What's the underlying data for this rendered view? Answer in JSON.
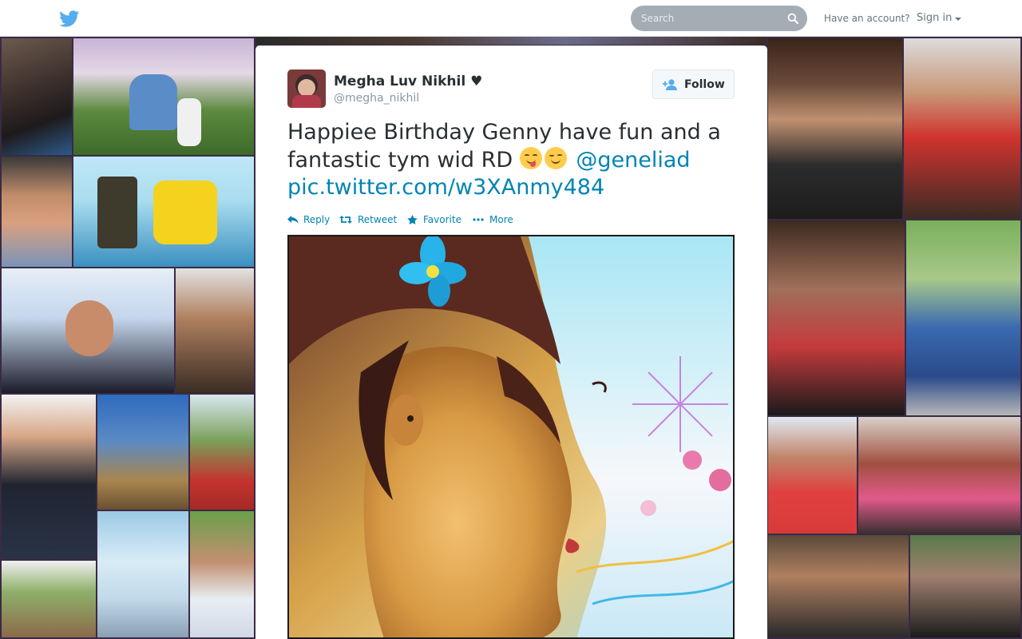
{
  "header": {
    "logo_icon": "twitter-bird-icon",
    "search": {
      "placeholder": "Search",
      "icon": "search-icon"
    },
    "have_account": "Have an account?",
    "signin_label": "Sign in",
    "brand_color": "#55acee"
  },
  "tweet": {
    "author": {
      "full_name": "Megha Luv Nikhil ♥",
      "screen_name": "@megha_nikhil"
    },
    "follow_label": "Follow",
    "text": "Happiee Birthday Genny have fun and a fantastic tym wid RD",
    "emojis": [
      "yum-face-emoji",
      "winking-face-emoji"
    ],
    "mention": "@geneliad",
    "pic_link": "pic.twitter.com/w3XAnmy484",
    "link_color": "#0084b4",
    "actions": [
      {
        "label": "Reply",
        "icon": "reply-icon"
      },
      {
        "label": "Retweet",
        "icon": "retweet-icon"
      },
      {
        "label": "Favorite",
        "icon": "star-icon"
      },
      {
        "label": "More",
        "icon": "more-dots-icon"
      }
    ]
  }
}
